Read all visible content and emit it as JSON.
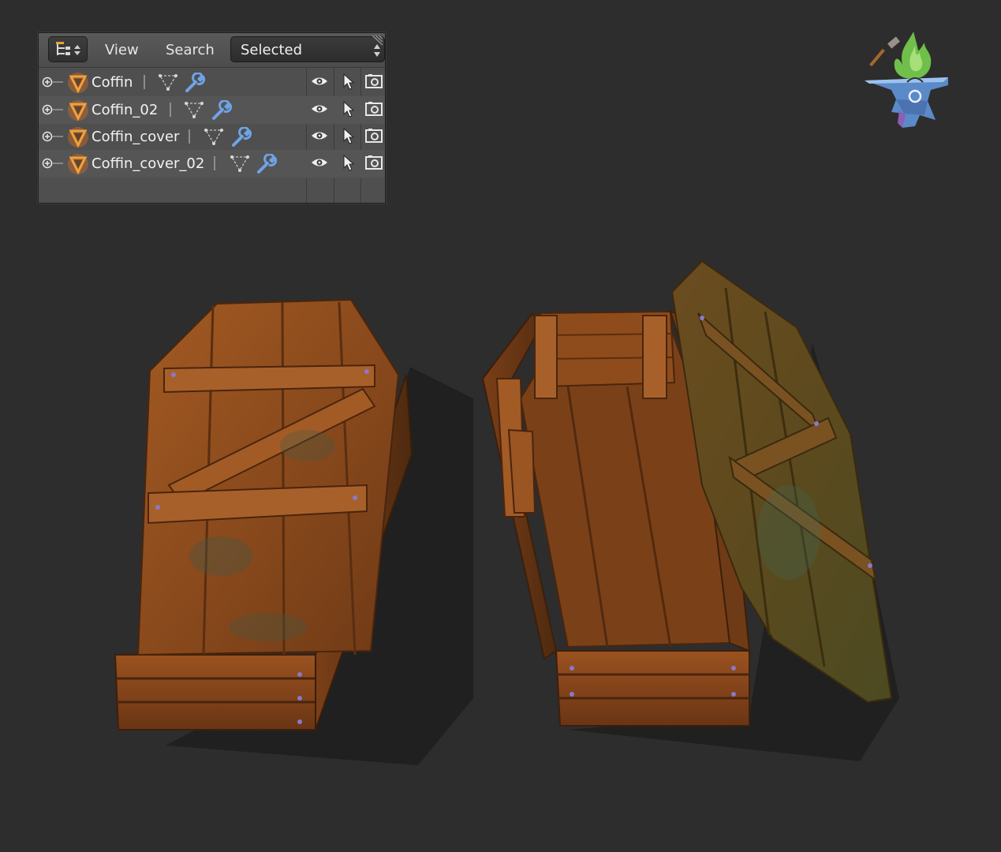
{
  "outliner": {
    "menu": {
      "view": "View",
      "search": "Search",
      "display_mode": "Selected"
    },
    "rows": [
      {
        "name": "Coffin"
      },
      {
        "name": "Coffin_02"
      },
      {
        "name": "Coffin_cover"
      },
      {
        "name": "Coffin_cover_02"
      }
    ],
    "icons": {
      "editor_type": "outliner-editor-icon",
      "expand": "expand-plus-icon",
      "object": "mesh-object-icon",
      "mesh_data": "mesh-data-icon",
      "modifier": "wrench-icon",
      "visibility": "eye-icon",
      "selectability": "cursor-icon",
      "renderability": "camera-icon"
    }
  },
  "viewport": {
    "logo": "anvil-flame-logo",
    "objects": [
      "closed-coffin",
      "open-coffin-with-lid"
    ]
  },
  "colors": {
    "background": "#2d2d2d",
    "panel": "#4f4f4f",
    "object_icon": "#e07b2a",
    "wood": "#8a4b1f"
  }
}
